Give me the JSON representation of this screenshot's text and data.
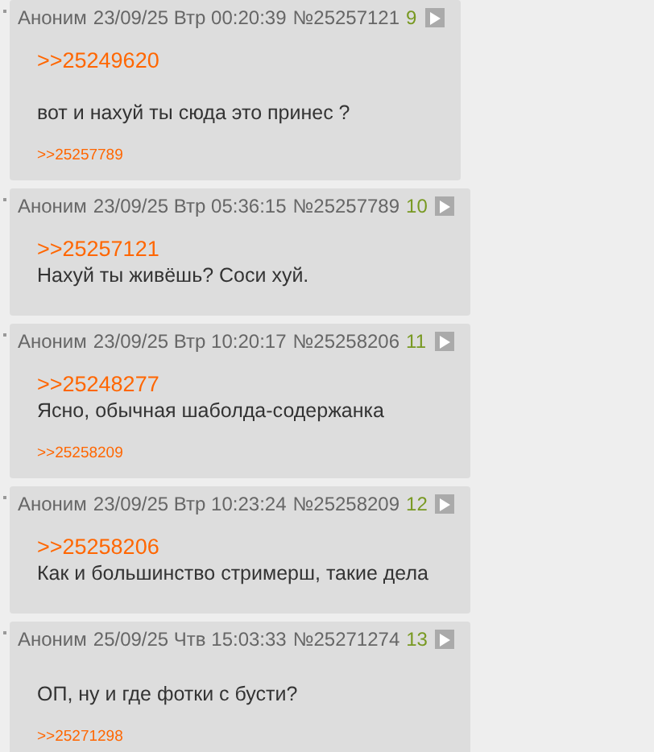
{
  "posts": [
    {
      "name": "Аноним",
      "date": "23/09/25 Втр 00:20:39",
      "number": "№25257121",
      "ordinal": "9",
      "body": [
        {
          "kind": "quote",
          "text": ">>25249620"
        },
        {
          "kind": "break"
        },
        {
          "kind": "text",
          "text": "вот и нахуй ты сюда это принес ?"
        }
      ],
      "replies": [
        ">>25257789"
      ]
    },
    {
      "name": "Аноним",
      "date": "23/09/25 Втр 05:36:15",
      "number": "№25257789",
      "ordinal": "10",
      "body": [
        {
          "kind": "quote",
          "text": ">>25257121"
        },
        {
          "kind": "text",
          "text": "Нахуй ты живёшь? Соси хуй."
        }
      ]
    },
    {
      "name": "Аноним",
      "date": "23/09/25 Втр 10:20:17",
      "number": "№25258206",
      "ordinal": "11",
      "body": [
        {
          "kind": "quote",
          "text": ">>25248277"
        },
        {
          "kind": "text",
          "text": "Ясно, обычная шаболда-содержанка"
        }
      ],
      "replies": [
        ">>25258209"
      ]
    },
    {
      "name": "Аноним",
      "date": "23/09/25 Втр 10:23:24",
      "number": "№25258209",
      "ordinal": "12",
      "body": [
        {
          "kind": "quote",
          "text": ">>25258206"
        },
        {
          "kind": "text",
          "text": "Как и большинство стримерш, такие дела"
        }
      ]
    },
    {
      "name": "Аноним",
      "date": "25/09/25 Чтв 15:03:33",
      "number": "№25271274",
      "ordinal": "13",
      "body": [
        {
          "kind": "text",
          "text": "ОП, ну и где фотки с бусти?"
        }
      ],
      "replies": [
        ">>25271298"
      ]
    }
  ]
}
